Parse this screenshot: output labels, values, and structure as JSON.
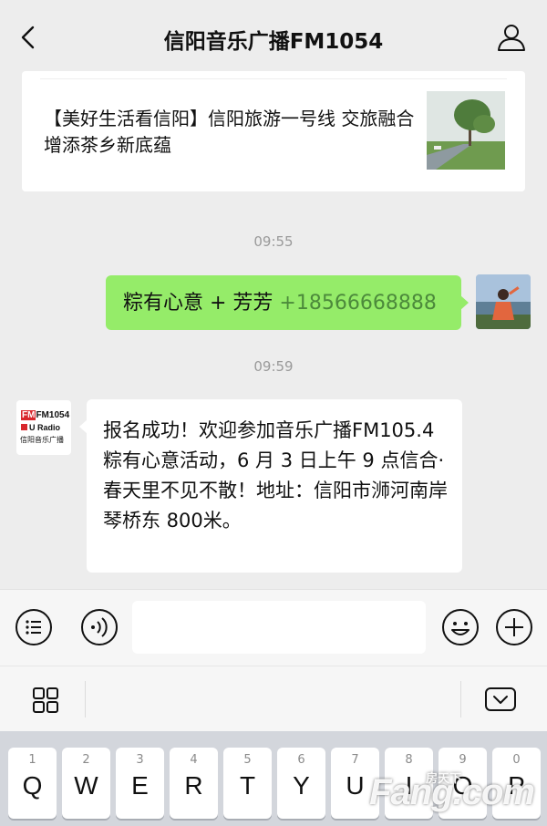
{
  "header": {
    "title": "信阳音乐广播FM1054",
    "back_icon": "chevron-left-icon",
    "profile_icon": "person-icon"
  },
  "article": {
    "text": "【美好生活看信阳】信阳旅游一号线 交旅融合增添茶乡新底蕴"
  },
  "messages": {
    "time1": "09:55",
    "sent_text": "粽有心意 + 芳芳 ",
    "sent_phone": "+18566668888",
    "time2": "09:59",
    "recv_text": "报名成功！欢迎参加音乐广播FM105.4 粽有心意活动，6 月 3 日上午 9 点信合·春天里不见不散！地址：信阳市浉河南岸琴桥东 800米。"
  },
  "fm_logo": {
    "line1": "FM1054",
    "line2": "U Radio",
    "line3": "信阳音乐广播"
  },
  "keyboard": {
    "keys": [
      {
        "num": "1",
        "letter": "Q"
      },
      {
        "num": "2",
        "letter": "W"
      },
      {
        "num": "3",
        "letter": "E"
      },
      {
        "num": "4",
        "letter": "R"
      },
      {
        "num": "5",
        "letter": "T"
      },
      {
        "num": "6",
        "letter": "Y"
      },
      {
        "num": "7",
        "letter": "U"
      },
      {
        "num": "8",
        "letter": "I"
      },
      {
        "num": "9",
        "letter": "O"
      },
      {
        "num": "0",
        "letter": "P"
      }
    ]
  },
  "watermark": {
    "main": "Fang.com",
    "sub": "房天下"
  },
  "colors": {
    "sent_bubble": "#95ec69",
    "phone_link": "#4c8a3b",
    "background": "#ededed"
  }
}
